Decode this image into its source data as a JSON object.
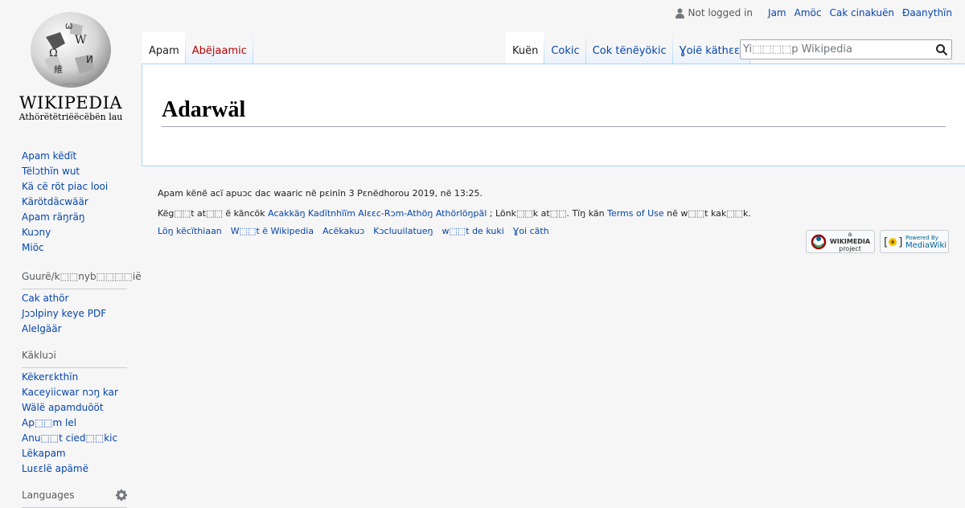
{
  "logo": {
    "wordmark": "WIKIPEDIA",
    "tagline": "Athörëtëtriëëcëbën lau"
  },
  "personal": {
    "not_logged_in": "Not logged in",
    "links": [
      "Jam",
      "Amöc",
      "Cak cinakuën",
      "Ɖaanythïn"
    ]
  },
  "tabs": {
    "left": [
      {
        "label": "Apam",
        "selected": true
      },
      {
        "label": "Abëjaamic",
        "new": true
      }
    ],
    "right": [
      {
        "label": "Kuën",
        "selected": true
      },
      {
        "label": "Cokic"
      },
      {
        "label": "Cok tënëyökic"
      },
      {
        "label": "Ɣoië käthɛɛr"
      }
    ]
  },
  "search": {
    "placeholder": "Yi⬚⬚⬚⬚p Wikipedia"
  },
  "page": {
    "title": "Adarwäl"
  },
  "sidebar": {
    "navigation": [
      "Apam këdït",
      "Tëlɔthïn wut",
      "Kä cë röt piac looi",
      "Kärötdäcwäär",
      "Apam räŋräŋ",
      "Kuɔny",
      "Miöc"
    ],
    "print": {
      "heading": "Guurë/k⬚⬚nyb⬚⬚⬚⬚iё",
      "items": [
        "Cak athör",
        "Jɔɔlpiny keye PDF",
        "Alelgäär"
      ]
    },
    "tools": {
      "heading": "Käkluɔi",
      "items": [
        "Këkerɛkthïn",
        "Kaceyiicwar nɔŋ kar",
        "Wälë apamduööt",
        "Ap⬚⬚m lel",
        "Anu⬚⬚t cied⬚⬚kic",
        "Lëkapam",
        "Luɛɛlë apämë"
      ]
    },
    "languages": {
      "heading": "Languages"
    }
  },
  "footer": {
    "last_modified": "Apam kënë acï apuɔc dac waaric në pɛinïn 3 Pɛnëdhorou 2019, në 13:25.",
    "license": {
      "pre": "Këg⬚⬚t at⬚⬚ ë käncök ",
      "link1": "Acakkäŋ Kadïtnhïïm Alɛɛc-Rɔm-Athöŋ Athörlöŋpäl",
      "mid": " ; Lönk⬚⬚k at⬚⬚. Tïŋ kän ",
      "link2": "Terms of Use",
      "post": " në w⬚⬚t kak⬚⬚k."
    },
    "places": [
      "Löŋ këcïthiaan",
      "W⬚⬚t ë Wikipedia",
      "Acëkakuɔ",
      "Kɔcluuilatueŋ",
      "w⬚⬚t de kuki",
      "Ɣoi cäth"
    ],
    "badges": {
      "wikimedia": [
        "a",
        "WIKIMEDIA",
        "project"
      ],
      "mediawiki": [
        "Powered By",
        "MediaWiki"
      ]
    }
  },
  "colors": {
    "link": "#0645ad",
    "new_link": "#ba0000",
    "border": "#a7d7f9",
    "background": "#f6f6f6"
  }
}
